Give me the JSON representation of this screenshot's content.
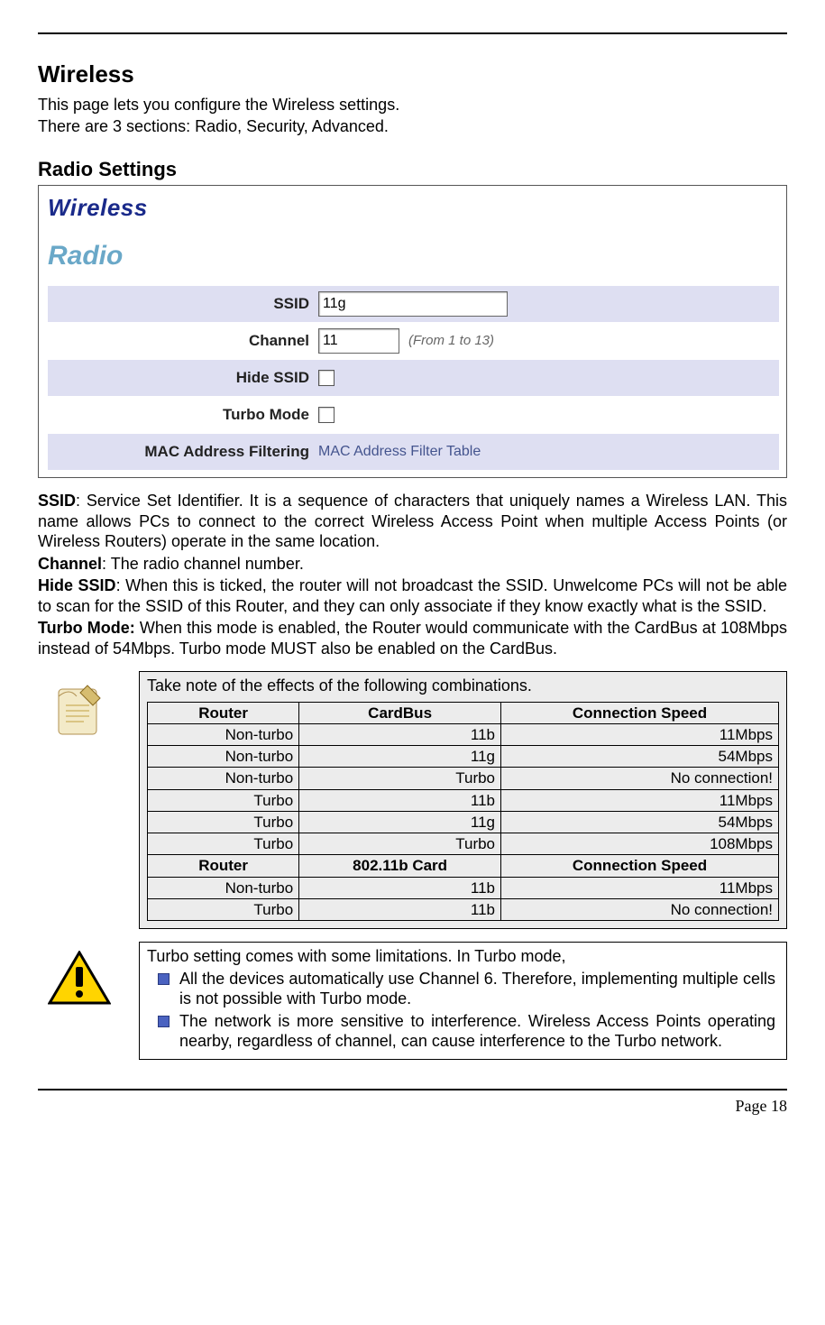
{
  "page": {
    "title": "Wireless",
    "intro_line1": "This page lets you configure the Wireless settings.",
    "intro_line2": "There are 3 sections: Radio, Security, Advanced.",
    "radio_heading": "Radio Settings",
    "footer": "Page 18"
  },
  "panel": {
    "main_title": "Wireless",
    "section_title": "Radio",
    "rows": {
      "ssid_label": "SSID",
      "ssid_value": "11g",
      "channel_label": "Channel",
      "channel_value": "11",
      "channel_hint": "(From 1 to 13)",
      "hide_ssid_label": "Hide SSID",
      "turbo_label": "Turbo Mode",
      "mac_label": "MAC Address Filtering",
      "mac_link": "MAC Address Filter Table"
    }
  },
  "defs": {
    "ssid_b": "SSID",
    "ssid_t": ": Service Set Identifier. It is a sequence of characters that uniquely names a Wireless LAN. This name allows PCs to connect to the correct Wireless Access Point when multiple Access Points (or Wireless Routers) operate in the same location.",
    "channel_b": "Channel",
    "channel_t": ": The radio channel number.",
    "hide_b": "Hide SSID",
    "hide_t": ": When this is ticked, the router will not broadcast the SSID. Unwelcome PCs will not be able to scan for the SSID of this Router, and they can only associate if they know exactly what is the SSID.",
    "turbo_b": "Turbo Mode:",
    "turbo_t": " When this mode is enabled, the Router would communicate with the CardBus at 108Mbps instead of 54Mbps. Turbo mode MUST also be enabled on the CardBus."
  },
  "note": {
    "lead": "Take note of the effects of the following combinations.",
    "hdr1": {
      "a": "Router",
      "b": "CardBus",
      "c": "Connection Speed"
    },
    "rows1": [
      {
        "a": "Non-turbo",
        "b": "11b",
        "c": "11Mbps"
      },
      {
        "a": "Non-turbo",
        "b": "11g",
        "c": "54Mbps"
      },
      {
        "a": "Non-turbo",
        "b": "Turbo",
        "c": "No connection!"
      },
      {
        "a": "Turbo",
        "b": "11b",
        "c": "11Mbps"
      },
      {
        "a": "Turbo",
        "b": "11g",
        "c": "54Mbps"
      },
      {
        "a": "Turbo",
        "b": "Turbo",
        "c": "108Mbps"
      }
    ],
    "hdr2": {
      "a": "Router",
      "b": "802.11b Card",
      "c": "Connection Speed"
    },
    "rows2": [
      {
        "a": "Non-turbo",
        "b": "11b",
        "c": "11Mbps"
      },
      {
        "a": "Turbo",
        "b": "11b",
        "c": "No connection!"
      }
    ]
  },
  "warn": {
    "lead": "Turbo setting comes with some limitations. In Turbo mode,",
    "b1": "All the devices automatically use Channel 6. Therefore, implementing multiple cells is not possible with Turbo mode.",
    "b2": "The network is more sensitive to interference. Wireless Access Points operating nearby, regardless of channel, can cause interference to the Turbo network."
  }
}
